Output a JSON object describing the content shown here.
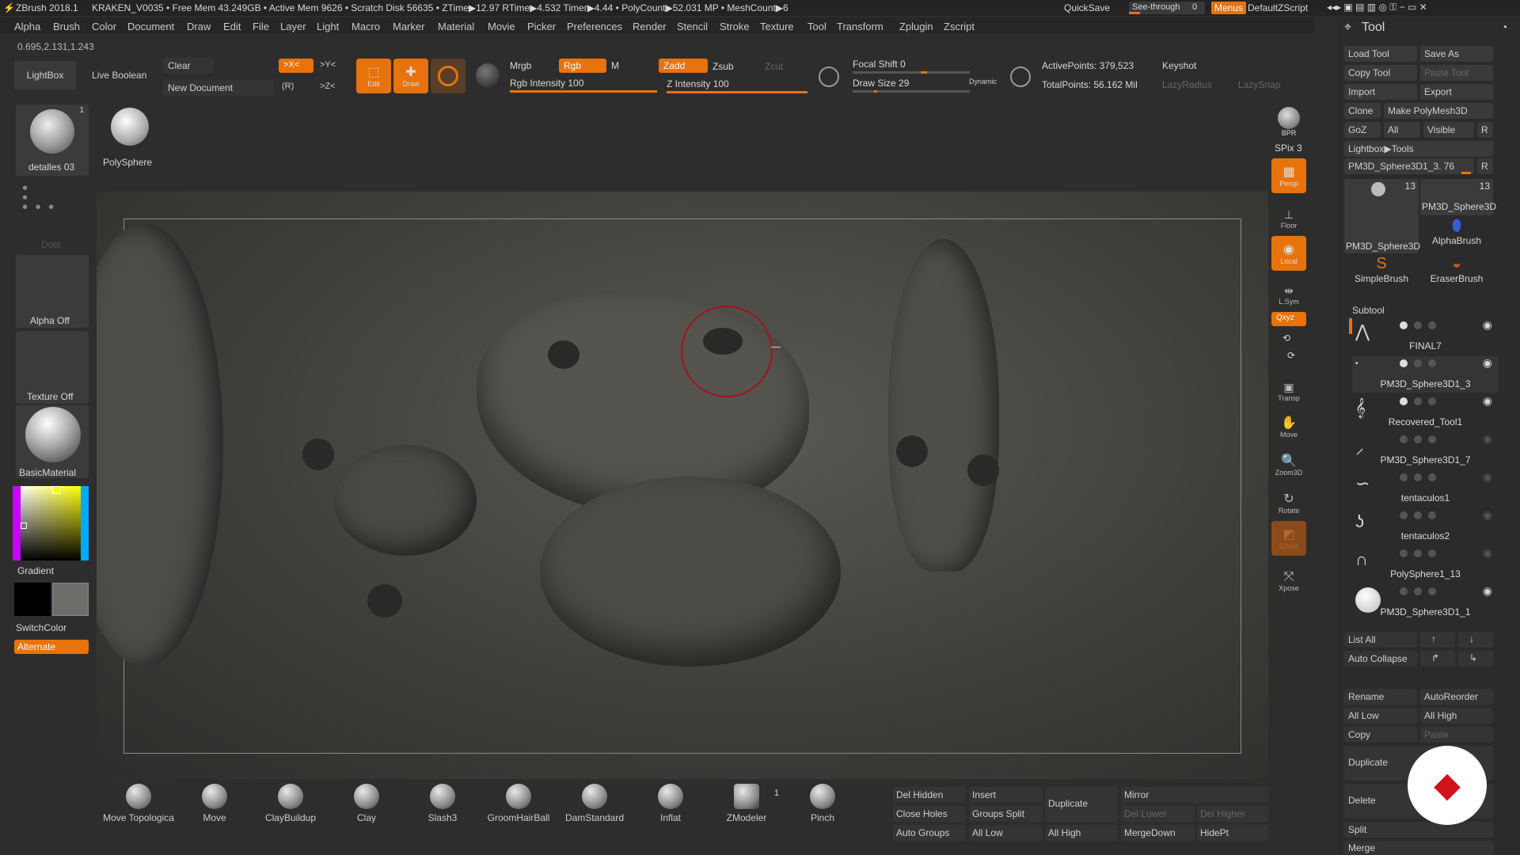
{
  "titlebar": {
    "app": "ZBrush 2018.1",
    "doc": "KRAKEN_V0035",
    "stats": "• Free Mem 43.249GB • Active Mem 9626 • Scratch Disk 56635 • ZTime▶12.97 RTime▶4.532 Timer▶4.44 • PolyCount▶52.031 MP • MeshCount▶6",
    "quicksave": "QuickSave",
    "seethrough": "See-through",
    "seethrough_val": "0",
    "menus": "Menus",
    "script": "DefaultZScript"
  },
  "menu": [
    "Alpha",
    "Brush",
    "Color",
    "Document",
    "Draw",
    "Edit",
    "File",
    "Layer",
    "Light",
    "Macro",
    "Marker",
    "Material",
    "Movie",
    "Picker",
    "Preferences",
    "Render",
    "Stencil",
    "Stroke",
    "Texture",
    "Tool",
    "Transform",
    "Zplugin",
    "Zscript"
  ],
  "coords": "0.695,2.131,1.243",
  "toolbar": {
    "lightbox": "LightBox",
    "live_boolean": "Live Boolean",
    "clear": "Clear",
    "new_document": "New Document",
    "x_sym": ">X<",
    "y_sym": ">Y<",
    "z_sym": ">Z<",
    "r_sym": "(R)",
    "edit": "Edit",
    "draw": "Draw",
    "mrgb": "Mrgb",
    "rgb": "Rgb",
    "m": "M",
    "rgb_intensity": "Rgb Intensity 100",
    "zadd": "Zadd",
    "zsub": "Zsub",
    "zcut": "Zcut",
    "z_intensity": "Z Intensity 100",
    "focal_shift": "Focal Shift 0",
    "draw_size": "Draw Size 29",
    "dynamic": "Dynamic",
    "active_points": "ActivePoints: 379,523",
    "total_points": "TotalPoints: 56.162 Mil",
    "keyshot": "Keyshot",
    "lazy_radius": "LazyRadius",
    "lazy_snap": "LazySnap",
    "rgb_intensity_value": 100,
    "z_intensity_value": 100,
    "draw_size_value": 29
  },
  "left": {
    "brush_label": "detalles 03",
    "brush_count": "1",
    "polysphere": "PolySphere",
    "dots": "Dots",
    "alpha": "Alpha Off",
    "texture": "Texture Off",
    "material": "BasicMaterial",
    "gradient": "Gradient",
    "switchcolor": "SwitchColor",
    "alternate": "Alternate"
  },
  "shelf": {
    "bpr": "BPR",
    "spix": "SPix 3",
    "persp": "Persp",
    "floor": "Floor",
    "local": "Local",
    "lsym": "L.Sym",
    "xyz": "Qxyz",
    "transp": "Transp",
    "move": "Move",
    "zoom": "Zoom3D",
    "rotate": "Rotate",
    "ghost": "Ghost",
    "xpose": "Xpose"
  },
  "brushes": [
    {
      "label": "Move Topologica"
    },
    {
      "label": "Move"
    },
    {
      "label": "ClayBuildup"
    },
    {
      "label": "Clay"
    },
    {
      "label": "Slash3"
    },
    {
      "label": "GroomHairBall"
    },
    {
      "label": "DamStandard"
    },
    {
      "label": "Inflat"
    },
    {
      "label": "ZModeler"
    },
    {
      "label": "Pinch"
    }
  ],
  "zmodeler_count": "1",
  "bottom_actions": {
    "del_hidden": "Del Hidden",
    "insert": "Insert",
    "duplicate": "Duplicate",
    "mirror": "Mirror",
    "close_holes": "Close Holes",
    "groups_split": "Groups Split",
    "del_lower": "Del Lower",
    "del_higher": "Del Higher",
    "auto_groups": "Auto Groups",
    "all_low": "All Low",
    "all_high": "All High",
    "merge_down": "MergeDown",
    "hide_pt": "HidePt"
  },
  "tool": {
    "title": "Tool",
    "load_tool": "Load Tool",
    "save_as": "Save As",
    "copy_tool": "Copy Tool",
    "paste_tool": "Paste Tool",
    "import": "Import",
    "export": "Export",
    "clone": "Clone",
    "make_polymesh": "Make PolyMesh3D",
    "goz": "GoZ",
    "all": "All",
    "visible": "Visible",
    "r": "R",
    "lightbox_tools": "Lightbox▶Tools",
    "current_tool": "PM3D_Sphere3D1_3. 76",
    "thumb1_label": "PM3D_Sphere3D",
    "thumb1_count": "13",
    "thumb2_label": "PM3D_Sphere3D",
    "thumb2_count": "13",
    "alphabrush": "AlphaBrush",
    "simplebrush": "SimpleBrush",
    "eraserbrush": "EraserBrush",
    "subtool": "Subtool",
    "subtools": [
      {
        "name": "FINAL7"
      },
      {
        "name": "PM3D_Sphere3D1_3"
      },
      {
        "name": "Recovered_Tool1"
      },
      {
        "name": "PM3D_Sphere3D1_7"
      },
      {
        "name": "tentaculos1"
      },
      {
        "name": "tentaculos2"
      },
      {
        "name": "PolySphere1_13"
      },
      {
        "name": "PM3D_Sphere3D1_1"
      }
    ],
    "list_all": "List All",
    "auto_collapse": "Auto Collapse",
    "rename": "Rename",
    "auto_reorder": "AutoReorder",
    "all_low": "All Low",
    "all_high": "All High",
    "copy": "Copy",
    "paste": "Paste",
    "duplicate": "Duplicate",
    "delete": "Delete",
    "split": "Split",
    "merge": "Merge"
  },
  "colors": {
    "accent": "#e8730c",
    "bg": "#2d2d2d",
    "panel": "#3a3a3a"
  }
}
